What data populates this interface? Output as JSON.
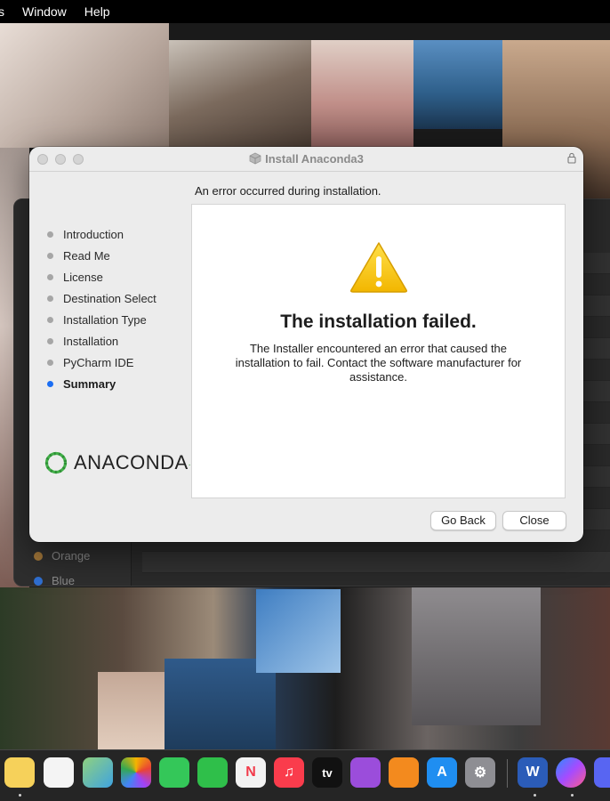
{
  "menubar": {
    "items": [
      "s",
      "Window",
      "Help"
    ]
  },
  "background_app": {
    "tags": [
      {
        "label": "Orange",
        "color": "#a4783a"
      },
      {
        "label": "Blue",
        "color": "#2f6fd1"
      }
    ]
  },
  "installer": {
    "title": "Install Anaconda3",
    "header": "An error occurred during installation.",
    "steps": [
      {
        "label": "Introduction"
      },
      {
        "label": "Read Me"
      },
      {
        "label": "License"
      },
      {
        "label": "Destination Select"
      },
      {
        "label": "Installation Type"
      },
      {
        "label": "Installation"
      },
      {
        "label": "PyCharm IDE"
      },
      {
        "label": "Summary"
      }
    ],
    "active_step": "Summary",
    "logo_text": "ANACONDA",
    "result_title": "The installation failed.",
    "result_message": "The Installer encountered an error that caused the installation to fail. Contact the software manufacturer for assistance.",
    "buttons": {
      "go_back": "Go Back",
      "close": "Close"
    },
    "accent_color": "#1b6ef3",
    "warning_color": "#f5c400"
  },
  "dock": {
    "apps": [
      {
        "icon": "notes-icon",
        "color": "#f6d15a"
      },
      {
        "icon": "reminders-icon",
        "color": "#f4f4f4"
      },
      {
        "icon": "maps-icon",
        "color": "#5fb55d"
      },
      {
        "icon": "photos-icon",
        "color": "#ffffff"
      },
      {
        "icon": "messages-icon",
        "color": "#34c759"
      },
      {
        "icon": "facetime-icon",
        "color": "#2fbf4a"
      },
      {
        "icon": "news-icon",
        "color": "#f2f2f2"
      },
      {
        "icon": "music-icon",
        "color": "#fa3c4c"
      },
      {
        "icon": "apple-tv-icon",
        "color": "#111111"
      },
      {
        "icon": "podcasts-icon",
        "color": "#9b4ddb"
      },
      {
        "icon": "books-icon",
        "color": "#f38a1e"
      },
      {
        "icon": "app-store-icon",
        "color": "#1f8ef1"
      },
      {
        "icon": "system-preferences-icon",
        "color": "#8e8e93"
      },
      {
        "icon": "word-icon",
        "color": "#2b5cb8"
      },
      {
        "icon": "messenger-icon",
        "color": "#8a4bff"
      },
      {
        "icon": "discord-icon",
        "color": "#5865f2"
      }
    ],
    "apple_tv_label": "tv",
    "word_label": "W"
  }
}
